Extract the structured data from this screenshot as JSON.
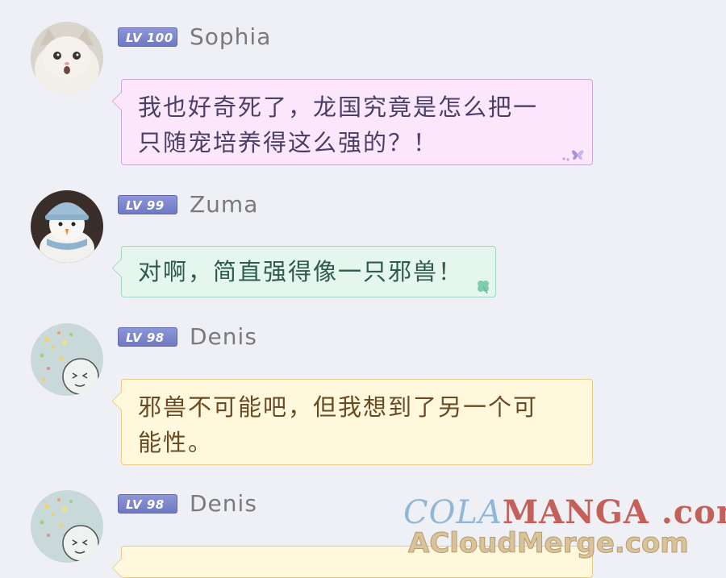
{
  "messages": [
    {
      "level": "LV 100",
      "username": "Sophia",
      "avatar": "cat-avatar",
      "text_lines": [
        "我也好奇死了，龙国究竟是怎么把一",
        "只随宠培养得这么强的？！"
      ],
      "bubble_color": "#fbe6fb",
      "decoration": "butterfly-icon"
    },
    {
      "level": "LV 99",
      "username": "Zuma",
      "avatar": "snowman-avatar",
      "text_lines": [
        "对啊，简直强得像一只邪兽！"
      ],
      "bubble_color": "#e5f6ef",
      "decoration": "clover-icon"
    },
    {
      "level": "LV 98",
      "username": "Denis",
      "avatar": "doodle-face-avatar",
      "text_lines": [
        "邪兽不可能吧，但我想到了另一个可",
        "能性。"
      ],
      "bubble_color": "#fff8dc",
      "decoration": ""
    },
    {
      "level": "LV 98",
      "username": "Denis",
      "avatar": "doodle-face-avatar",
      "text_lines": [],
      "bubble_color": "#fff8dc",
      "decoration": ""
    }
  ],
  "watermark": {
    "part1": "COLA",
    "part2": "MANGA",
    "part3": ".com",
    "line2": "ACloudMerge.com"
  },
  "colors": {
    "background": "#eef0f5",
    "badge": "#7d87cd",
    "username": "#7a7a7a"
  }
}
